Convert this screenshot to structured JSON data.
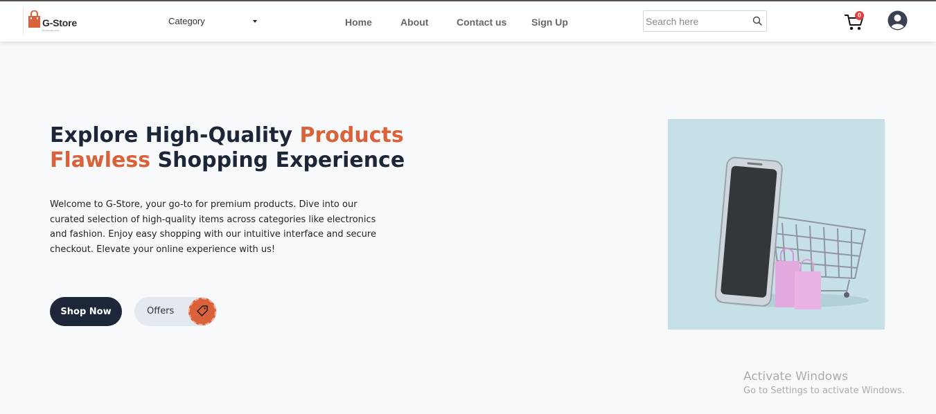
{
  "header": {
    "brand": "G-Store",
    "tagline": "My everyday store",
    "category_label": "Category",
    "nav": [
      {
        "label": "Home"
      },
      {
        "label": "About"
      },
      {
        "label": "Contact us"
      },
      {
        "label": "Sign Up"
      }
    ],
    "search": {
      "placeholder": "Search here",
      "value": ""
    },
    "cart_count": "0"
  },
  "hero": {
    "title_part1": "Explore High-Quality ",
    "title_accent1": "Products",
    "title_accent2": "Flawless",
    "title_part2": " Shopping Experience",
    "description": "Welcome to G-Store, your go-to for premium products. Dive into our curated selection of high-quality items across categories like electronics and fashion. Enjoy easy shopping with our intuitive interface and secure checkout. Elevate your online experience with us!",
    "shop_button": "Shop Now",
    "offers_button": "Offers"
  },
  "watermark": {
    "line1": "Activate Windows",
    "line2": "Go to Settings to activate Windows."
  },
  "colors": {
    "accent": "#d9623b",
    "dark": "#1e2639",
    "badge": "#e33d3d"
  }
}
